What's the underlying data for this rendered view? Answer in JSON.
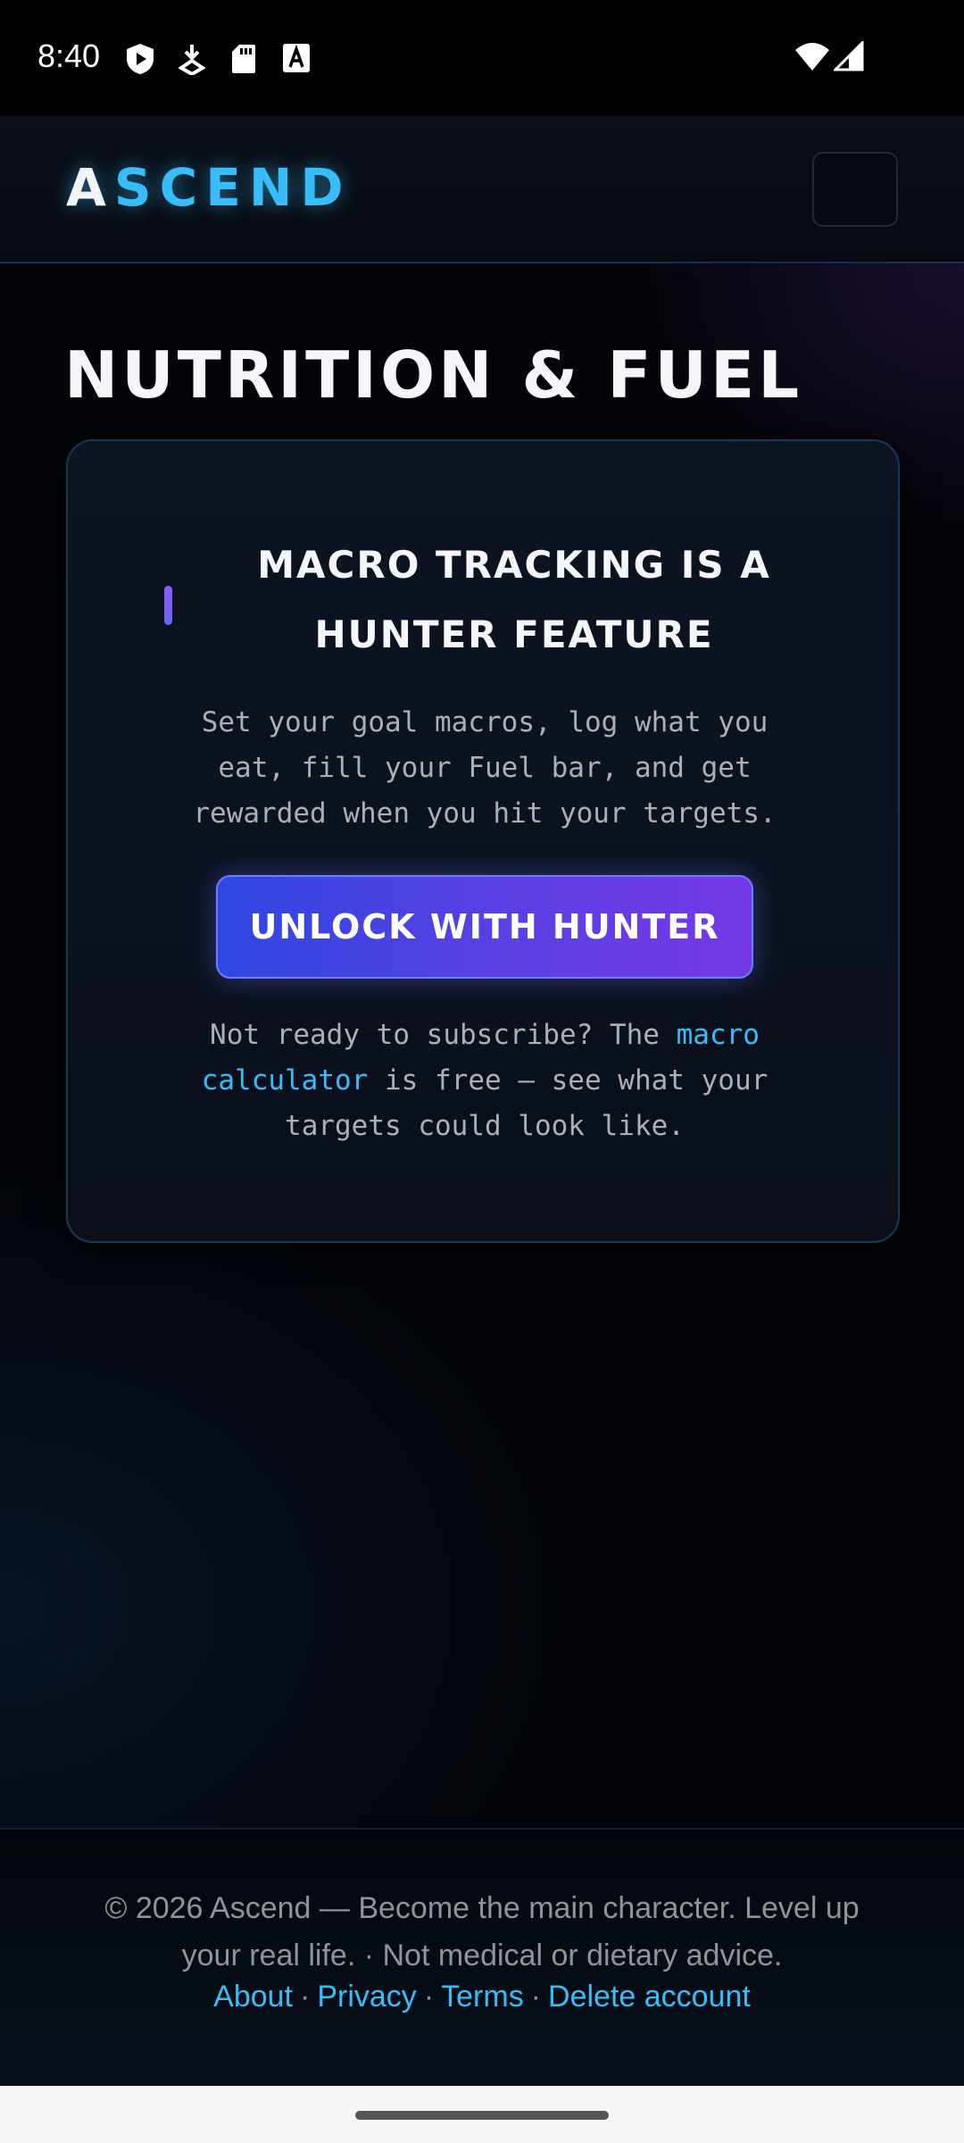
{
  "status_bar": {
    "time": "8:40",
    "icons": [
      "shield-play-icon",
      "download-icon",
      "sd-card-icon",
      "font-a-icon",
      "wifi-icon",
      "signal-icon"
    ]
  },
  "header": {
    "logo_first": "A",
    "logo_rest": "SCEND",
    "menu_button_icon": "menu-icon"
  },
  "page": {
    "title": "NUTRITION & FUEL"
  },
  "card": {
    "heading_line1": "MACRO TRACKING IS A",
    "heading_line2": "HUNTER FEATURE",
    "description_line1": "Set your goal macros, log what you",
    "description_line2": "eat, fill your Fuel bar, and get",
    "description_line3": "rewarded when you hit your targets.",
    "unlock_button": "UNLOCK WITH HUNTER",
    "note_part1": "Not ready to subscribe? The ",
    "note_link_line1": "macro",
    "note_link_line2": "calculator",
    "note_part2": " is free — see what your",
    "note_line3": "targets could look like."
  },
  "footer": {
    "text_line1": "© 2026 Ascend — Become the main character. Level up",
    "text_line2": "your real life. · Not medical or dietary advice.",
    "links": [
      "About",
      "Privacy",
      "Terms",
      "Delete account"
    ],
    "separator": "·"
  },
  "colors": {
    "accent": "#38bdf8",
    "button_gradient_start": "#2f47e2",
    "button_gradient_end": "#7539e6",
    "background": "#03050a"
  }
}
